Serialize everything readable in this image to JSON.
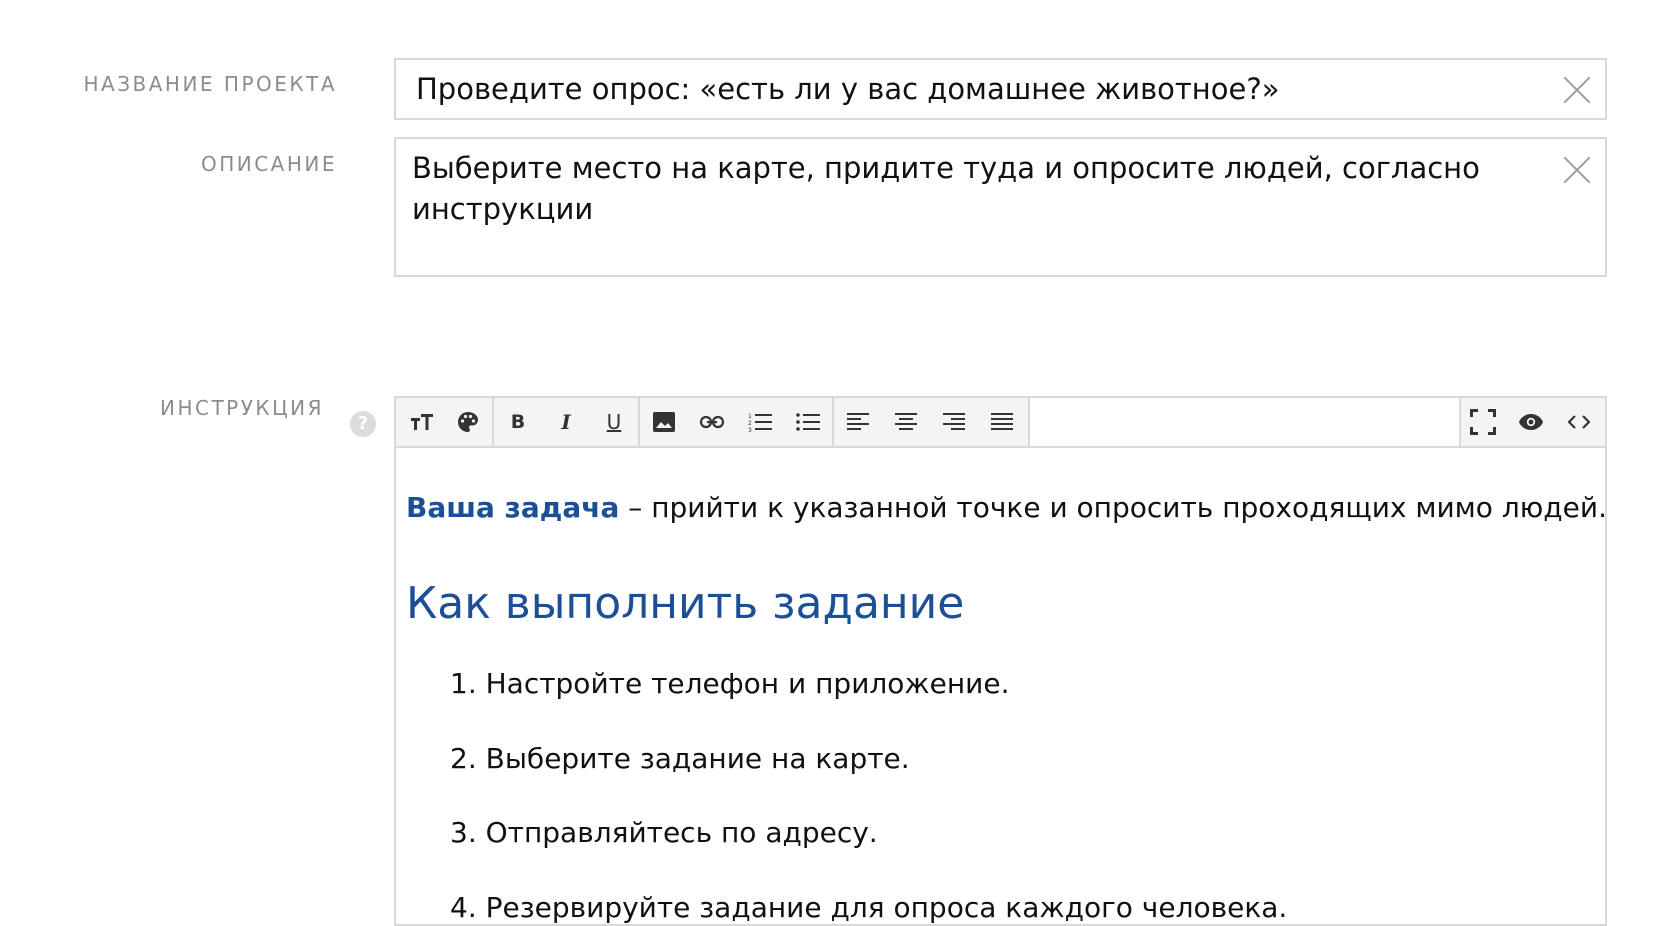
{
  "project_name": {
    "label": "НАЗВАНИЕ ПРОЕКТА",
    "value": "Проведите опрос: «есть ли у вас домашнее животное?»"
  },
  "description": {
    "label": "ОПИСАНИЕ",
    "value": "Выберите место на карте, придите туда и опросите людей, согласно\nинструкции"
  },
  "instruction": {
    "label": "ИНСТРУКЦИЯ",
    "help": "?",
    "toolbar": {
      "heading_icon": "text-size-icon",
      "color_icon": "palette-icon",
      "bold": "B",
      "italic": "I",
      "underline": "U",
      "image_icon": "image-icon",
      "link_icon": "link-icon",
      "ordered_list_icon": "ordered-list-icon",
      "unordered_list_icon": "unordered-list-icon",
      "align_left_icon": "align-left-icon",
      "align_center_icon": "align-center-icon",
      "align_right_icon": "align-right-icon",
      "align_justify_icon": "align-justify-icon",
      "fullscreen_icon": "fullscreen-icon",
      "preview_icon": "eye-icon",
      "source_icon": "code-icon"
    },
    "content": {
      "intro_strong": "Ваша задача",
      "intro_rest": " – прийти к указанной точке и опросить проходящих мимо людей.",
      "heading": "Как выполнить задание",
      "steps": [
        "1. Настройте телефон и приложение.",
        "2. Выберите задание на карте.",
        "3. Отправляйтесь по адресу.",
        "4. Резервируйте задание для опроса каждого человека."
      ]
    }
  },
  "colors": {
    "accent": "#1b4f96",
    "label": "#8c8c8c",
    "border": "#d9d9d9",
    "toolbar_bg": "#f5f4f3"
  }
}
